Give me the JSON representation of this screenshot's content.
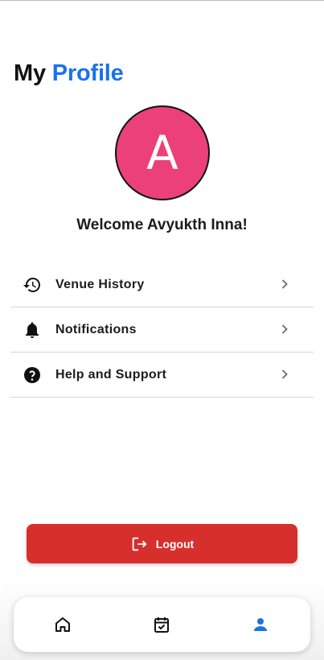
{
  "header": {
    "title_part1": "My",
    "title_part2": "Profile"
  },
  "profile": {
    "avatar_initial": "A",
    "welcome_text": "Welcome Avyukth Inna!"
  },
  "menu": {
    "items": [
      {
        "label": "Venue History",
        "icon": "history-icon"
      },
      {
        "label": "Notifications",
        "icon": "bell-icon"
      },
      {
        "label": "Help and Support",
        "icon": "help-icon"
      }
    ]
  },
  "logout": {
    "label": "Logout"
  },
  "bottom_nav": {
    "items": [
      {
        "icon": "home-icon",
        "active": false
      },
      {
        "icon": "calendar-check-icon",
        "active": false
      },
      {
        "icon": "person-icon",
        "active": true
      }
    ]
  },
  "colors": {
    "accent": "#1a73e8",
    "avatar_bg": "#ec407a",
    "logout_bg": "#d62f2c"
  }
}
